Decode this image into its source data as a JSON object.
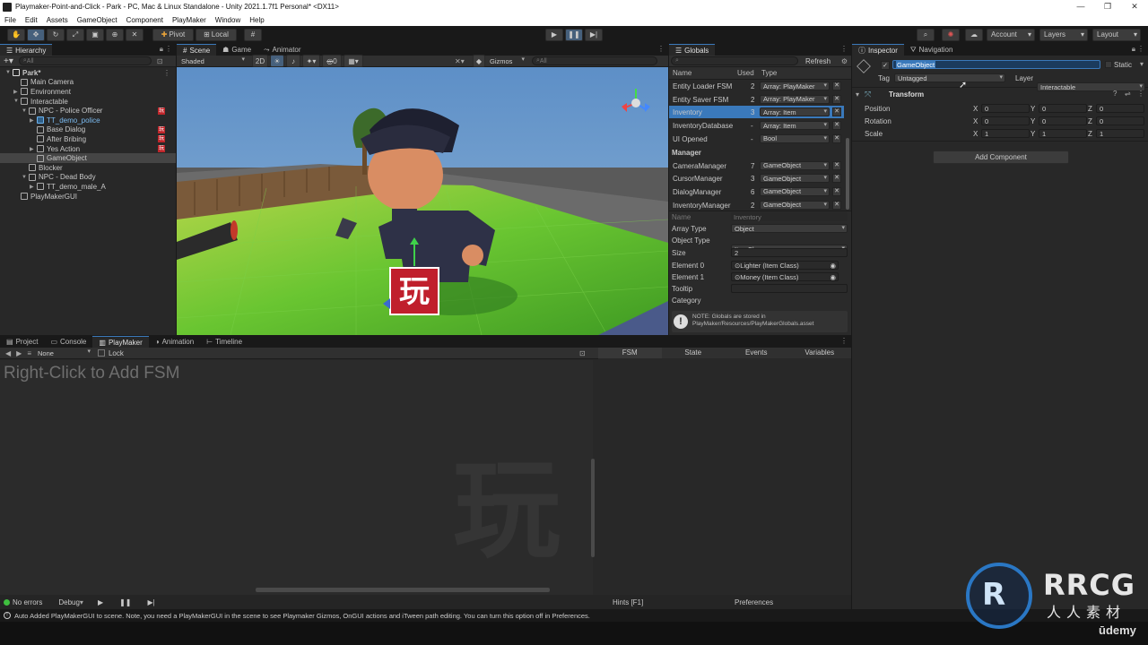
{
  "window": {
    "title": "Playmaker-Point-and-Click - Park - PC, Mac & Linux Standalone - Unity 2021.1.7f1 Personal* <DX11>"
  },
  "menu": [
    "File",
    "Edit",
    "Assets",
    "GameObject",
    "Component",
    "PlayMaker",
    "Window",
    "Help"
  ],
  "toolbar": {
    "pivot": "Pivot",
    "local": "Local",
    "account": "Account",
    "layers": "Layers",
    "layout": "Layout"
  },
  "hierarchy": {
    "tab": "Hierarchy",
    "search_placeholder": "All",
    "items": [
      {
        "label": "Park*",
        "depth": 0,
        "arrow": "▼"
      },
      {
        "label": "Main Camera",
        "depth": 1,
        "arrow": ""
      },
      {
        "label": "Environment",
        "depth": 1,
        "arrow": "▶"
      },
      {
        "label": "Interactable",
        "depth": 1,
        "arrow": "▼"
      },
      {
        "label": "NPC - Police Officer",
        "depth": 2,
        "arrow": "▼",
        "badge": "玩"
      },
      {
        "label": "TT_demo_police",
        "depth": 3,
        "arrow": "▶",
        "prefab": true
      },
      {
        "label": "Base Dialog",
        "depth": 3,
        "arrow": "",
        "badge": "玩"
      },
      {
        "label": "After Bribing",
        "depth": 3,
        "arrow": "",
        "badge": "玩"
      },
      {
        "label": "Yes Action",
        "depth": 3,
        "arrow": "▶",
        "badge": "玩"
      },
      {
        "label": "GameObject",
        "depth": 3,
        "arrow": "",
        "selected": true
      },
      {
        "label": "Blocker",
        "depth": 2,
        "arrow": ""
      },
      {
        "label": "NPC - Dead Body",
        "depth": 2,
        "arrow": "▼"
      },
      {
        "label": "TT_demo_male_A",
        "depth": 3,
        "arrow": "▶"
      },
      {
        "label": "PlayMakerGUI",
        "depth": 1,
        "arrow": ""
      }
    ]
  },
  "scene": {
    "tabs": [
      "Scene",
      "Game",
      "Animator"
    ],
    "shading": "Shaded",
    "mode2d": "2D",
    "gizmos": "Gizmos",
    "search_placeholder": "All",
    "fx_count": "0"
  },
  "globals": {
    "tab": "Globals",
    "refresh": "Refresh",
    "headers": {
      "name": "Name",
      "used": "Used",
      "type": "Type"
    },
    "rows": [
      {
        "name": "Entity Loader FSM",
        "used": "2",
        "type": "Array: PlayMaker"
      },
      {
        "name": "Entity Saver FSM",
        "used": "2",
        "type": "Array: PlayMaker"
      },
      {
        "name": "Inventory",
        "used": "3",
        "type": "Array: Item",
        "selected": true
      },
      {
        "name": "InventoryDatabase",
        "used": "-",
        "type": "Array: Item"
      },
      {
        "name": "UI Opened",
        "used": "-",
        "type": "Bool"
      }
    ],
    "section": "Manager",
    "manager_rows": [
      {
        "name": "CameraManager",
        "used": "7",
        "type": "GameObject"
      },
      {
        "name": "CursorManager",
        "used": "3",
        "type": "GameObject"
      },
      {
        "name": "DialogManager",
        "used": "6",
        "type": "GameObject"
      },
      {
        "name": "InventoryManager",
        "used": "2",
        "type": "GameObject"
      }
    ],
    "detail": {
      "name_label": "Name",
      "name_value": "Inventory",
      "array_type_label": "Array Type",
      "array_type": "Object",
      "object_type_label": "Object Type",
      "object_type": "ItemClass",
      "size_label": "Size",
      "size": "2",
      "element0_label": "Element 0",
      "element0": "Lighter (Item Class)",
      "element1_label": "Element 1",
      "element1": "Money (Item Class)",
      "tooltip_label": "Tooltip",
      "category_label": "Category",
      "note": "NOTE: Globals are stored in PlayMaker/Resources/PlayMakerGlobals.asset"
    }
  },
  "inspector": {
    "tabs": [
      "Inspector",
      "Navigation"
    ],
    "name": "GameObject",
    "static": "Static",
    "tag_label": "Tag",
    "tag": "Untagged",
    "layer_label": "Layer",
    "layer": "Interactable",
    "component": "Transform",
    "position_label": "Position",
    "rotation_label": "Rotation",
    "scale_label": "Scale",
    "position": [
      "0",
      "0",
      "0"
    ],
    "rotation": [
      "0",
      "0",
      "0"
    ],
    "scale": [
      "1",
      "1",
      "1"
    ],
    "add_component": "Add Component"
  },
  "bottom": {
    "tabs": [
      "Project",
      "Console",
      "PlayMaker",
      "Animation",
      "Timeline"
    ],
    "fsm_select": "None",
    "lock": "Lock",
    "hint": "Right-Click to Add FSM",
    "fsm_tabs": [
      "FSM",
      "State",
      "Events",
      "Variables"
    ],
    "status_errors": "No errors",
    "debug": "Debug",
    "hints": "Hints [F1]",
    "preferences": "Preferences"
  },
  "statusbar": "Auto Added PlayMakerGUI to scene. Note, you need a PlayMakerGUI in the scene to see Playmaker Gizmos, OnGUI actions and iTween path editing. You can turn this option off in Preferences.",
  "watermark": {
    "brand": "RRCG",
    "sub": "人人素材",
    "udemy": "ūdemy",
    "glyph": "玩"
  }
}
